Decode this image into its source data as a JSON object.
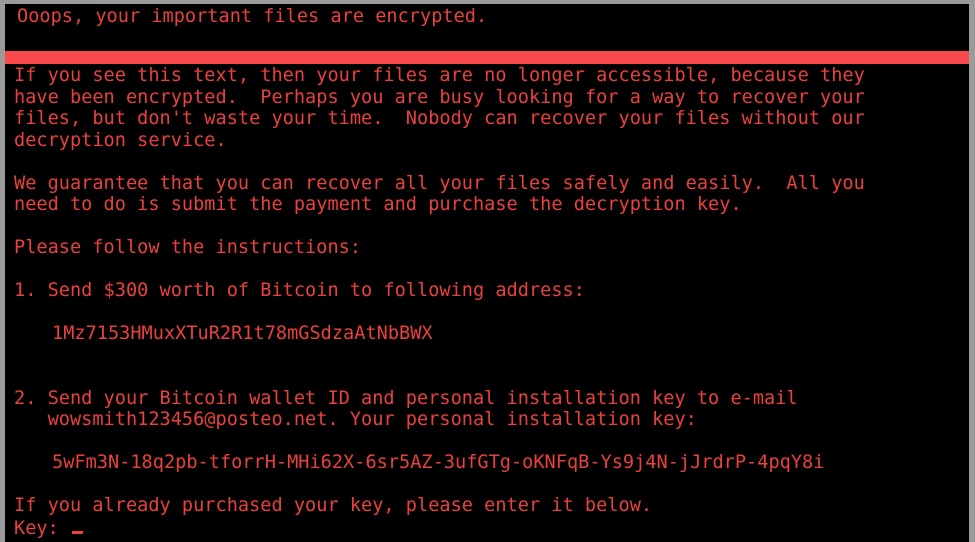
{
  "window": {
    "border_color": "#9a9a9a",
    "background": "#000000"
  },
  "theme": {
    "text_color": "#e8413f",
    "bar_color": "#f9494a",
    "background_color": "#000000"
  },
  "headline": "Ooops, your important files are encrypted.",
  "intro": {
    "line1": "If you see this text, then your files are no longer accessible, because they",
    "line2": "have been encrypted.  Perhaps you are busy looking for a way to recover your",
    "line3": "files, but don't waste your time.  Nobody can recover your files without our",
    "line4": "decryption service."
  },
  "guarantee": {
    "line1": "We guarantee that you can recover all your files safely and easily.  All you",
    "line2": "need to do is submit the payment and purchase the decryption key."
  },
  "instructions_heading": "Please follow the instructions:",
  "step1": {
    "text": "1. Send $300 worth of Bitcoin to following address:",
    "bitcoin_address": "1Mz7153HMuxXTuR2R1t78mGSdzaAtNbBWX"
  },
  "step2": {
    "line1": "2. Send your Bitcoin wallet ID and personal installation key to e-mail",
    "line2": "   wowsmith123456@posteo.net. Your personal installation key:",
    "installation_key": "5wFm3N-18q2pb-tforrH-MHi62X-6sr5AZ-3ufGTg-oKNFqB-Ys9j4N-jJrdrP-4pqY8i"
  },
  "footer": {
    "already_purchased": "If you already purchased your key, please enter it below.",
    "key_label": "Key: ",
    "key_value": ""
  }
}
